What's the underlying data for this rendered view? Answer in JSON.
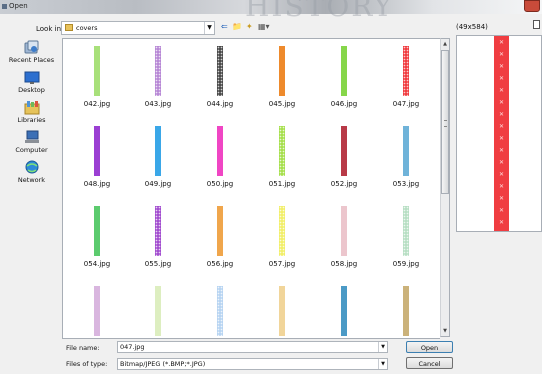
{
  "window": {
    "title": "Open",
    "background_letters": "HISTORY"
  },
  "toolbar": {
    "look_in_label": "Look in:",
    "look_in_value": "covers",
    "back_glyph": "⇐",
    "up_glyph": "📁",
    "newfolder_glyph": "✦",
    "views_glyph": "▦▾"
  },
  "places": [
    {
      "label": "Recent Places",
      "icon": "recent-places-icon"
    },
    {
      "label": "Desktop",
      "icon": "desktop-icon"
    },
    {
      "label": "Libraries",
      "icon": "libraries-icon"
    },
    {
      "label": "Computer",
      "icon": "computer-icon"
    },
    {
      "label": "Network",
      "icon": "network-icon"
    }
  ],
  "files": [
    {
      "name": "042.jpg",
      "color": "#a8e07a",
      "style": "plain"
    },
    {
      "name": "043.jpg",
      "color": "#b889d6",
      "style": "dotted"
    },
    {
      "name": "044.jpg",
      "color": "#4a4a4a",
      "style": "dotted"
    },
    {
      "name": "045.jpg",
      "color": "#ee8a2c",
      "style": "plain"
    },
    {
      "name": "046.jpg",
      "color": "#86d64a",
      "style": "plain"
    },
    {
      "name": "047.jpg",
      "color": "#f03d41",
      "style": "dotted"
    },
    {
      "name": "048.jpg",
      "color": "#9b3fd3",
      "style": "plain"
    },
    {
      "name": "049.jpg",
      "color": "#3aa7e8",
      "style": "plain"
    },
    {
      "name": "050.jpg",
      "color": "#f046c4",
      "style": "plain"
    },
    {
      "name": "051.jpg",
      "color": "#a7e04e",
      "style": "dotted"
    },
    {
      "name": "052.jpg",
      "color": "#b83a47",
      "style": "plain"
    },
    {
      "name": "053.jpg",
      "color": "#6fb3d9",
      "style": "plain"
    },
    {
      "name": "054.jpg",
      "color": "#5ccb6e",
      "style": "plain"
    },
    {
      "name": "055.jpg",
      "color": "#a34fd0",
      "style": "dotted"
    },
    {
      "name": "056.jpg",
      "color": "#f0a64c",
      "style": "plain"
    },
    {
      "name": "057.jpg",
      "color": "#f2ef6a",
      "style": "dotted"
    },
    {
      "name": "058.jpg",
      "color": "#ecc6cd",
      "style": "plain"
    },
    {
      "name": "059.jpg",
      "color": "#b8dfc4",
      "style": "dotted"
    },
    {
      "name": "",
      "color": "#d9b6df",
      "style": "plain"
    },
    {
      "name": "",
      "color": "#ddeec0",
      "style": "plain"
    },
    {
      "name": "",
      "color": "#b7d4f2",
      "style": "dotted"
    },
    {
      "name": "",
      "color": "#f1d59a",
      "style": "plain"
    },
    {
      "name": "",
      "color": "#4b9ac6",
      "style": "plain"
    },
    {
      "name": "",
      "color": "#cbb27a",
      "style": "plain"
    }
  ],
  "preview": {
    "dimensions": "(49x584)",
    "color": "#f03d41"
  },
  "filename": {
    "label": "File name:",
    "value": "047.jpg"
  },
  "filetype": {
    "label": "Files of type:",
    "value": "Bitmap/JPEG (*.BMP;*.JPG)"
  },
  "buttons": {
    "open": "Open",
    "cancel": "Cancel"
  }
}
